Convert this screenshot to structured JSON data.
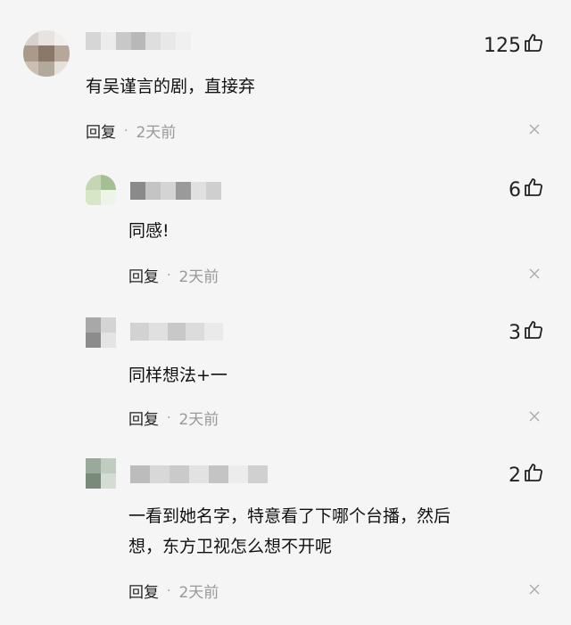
{
  "comments": [
    {
      "level": "top",
      "text": "有吴谨言的剧，直接弃",
      "likes": "125",
      "reply_label": "回复",
      "separator": "·",
      "time": "2天前",
      "avatar_colors": [
        "#d8d2cc",
        "#e8e3de",
        "#f2efec",
        "#a99a8a",
        "#8a7868",
        "#b7a79a",
        "#cbbfb4",
        "#b3a89c",
        "#e6e0da"
      ],
      "name_colors": [
        "#d6d6d6",
        "#ececec",
        "#c8c8c8",
        "#b8b8b8",
        "#dedede",
        "#e8e8e8",
        "#f0f0f0"
      ]
    },
    {
      "level": "reply",
      "text": "同感!",
      "likes": "6",
      "reply_label": "回复",
      "separator": "·",
      "time": "2天前",
      "avatar_colors": [
        "#c4d6b4",
        "#a4c093",
        "#d6e6c6",
        "#eef4e8"
      ],
      "name_colors": [
        "#8a8a8a",
        "#c4c4c4",
        "#d4d4d4",
        "#9a9a9a",
        "#e0e0e0",
        "#cfcfcf"
      ]
    },
    {
      "level": "reply",
      "text": "同样想法+一",
      "likes": "3",
      "reply_label": "回复",
      "separator": "·",
      "time": "2天前",
      "avatar_colors": [
        "#a8a8a8",
        "#d4d4d4",
        "#8c8c8c",
        "#e4e4e4"
      ],
      "name_colors": [
        "#d2d2d2",
        "#e0e0e0",
        "#c8c8c8",
        "#dcdcdc",
        "#eaeaea"
      ]
    },
    {
      "level": "reply",
      "text": "一看到她名字，特意看了下哪个台播，然后\n想，东方卫视怎么想不开呢",
      "likes": "2",
      "reply_label": "回复",
      "separator": "·",
      "time": "2天前",
      "avatar_colors": [
        "#9aaa9a",
        "#c0ccc0",
        "#7a8a7a",
        "#d4dcd4"
      ],
      "name_colors": [
        "#bcbcbc",
        "#d8d8d8",
        "#cacaca",
        "#e2e2e2",
        "#c4c4c4",
        "#ececec",
        "#d0d0d0"
      ]
    }
  ],
  "icons": {
    "like": "thumbs-up-icon",
    "close": "close-icon"
  }
}
